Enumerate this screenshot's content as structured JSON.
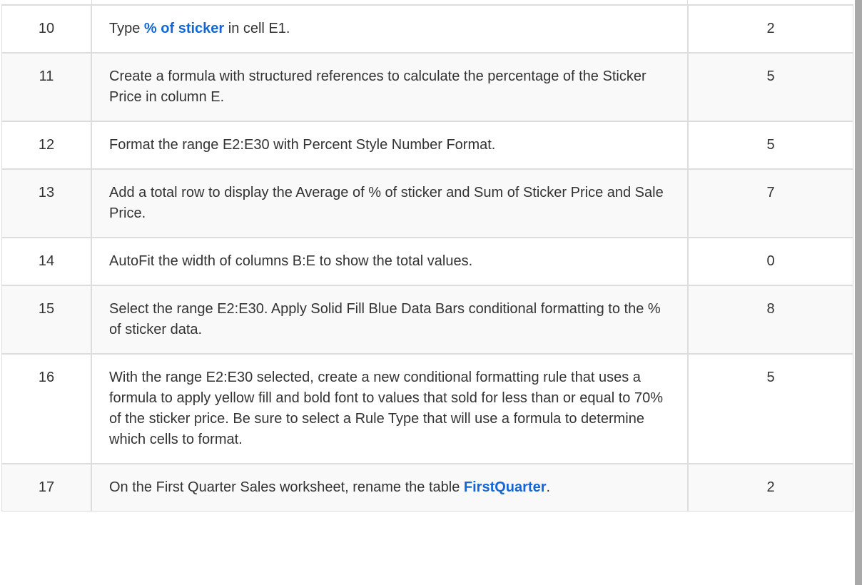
{
  "rows": [
    {
      "num": "10",
      "desc_parts": [
        {
          "text": "Type "
        },
        {
          "text": "% of sticker",
          "highlight": true
        },
        {
          "text": " in cell E1."
        }
      ],
      "points": "2"
    },
    {
      "num": "11",
      "desc_parts": [
        {
          "text": "Create a formula with structured references to calculate the percentage of the Sticker Price in column E."
        }
      ],
      "points": "5"
    },
    {
      "num": "12",
      "desc_parts": [
        {
          "text": "Format the range E2:E30 with Percent Style Number Format."
        }
      ],
      "points": "5"
    },
    {
      "num": "13",
      "desc_parts": [
        {
          "text": "Add a total row to display the Average of % of sticker and Sum of Sticker Price and Sale Price."
        }
      ],
      "points": "7"
    },
    {
      "num": "14",
      "desc_parts": [
        {
          "text": "AutoFit the width of columns B:E to show the total values."
        }
      ],
      "points": "0"
    },
    {
      "num": "15",
      "desc_parts": [
        {
          "text": "Select the range E2:E30. Apply Solid Fill Blue Data Bars conditional formatting to the % of sticker data."
        }
      ],
      "points": "8"
    },
    {
      "num": "16",
      "desc_parts": [
        {
          "text": "With the range E2:E30 selected, create a new conditional formatting rule that uses a formula to apply yellow fill and bold font to values that sold for less than or equal to 70% of the sticker price. Be sure to select a Rule Type that will use a formula to determine which cells to format."
        }
      ],
      "points": "5"
    },
    {
      "num": "17",
      "desc_parts": [
        {
          "text": "On the First Quarter Sales worksheet, rename the table "
        },
        {
          "text": "FirstQuarter",
          "highlight": true
        },
        {
          "text": "."
        }
      ],
      "points": "2"
    }
  ]
}
